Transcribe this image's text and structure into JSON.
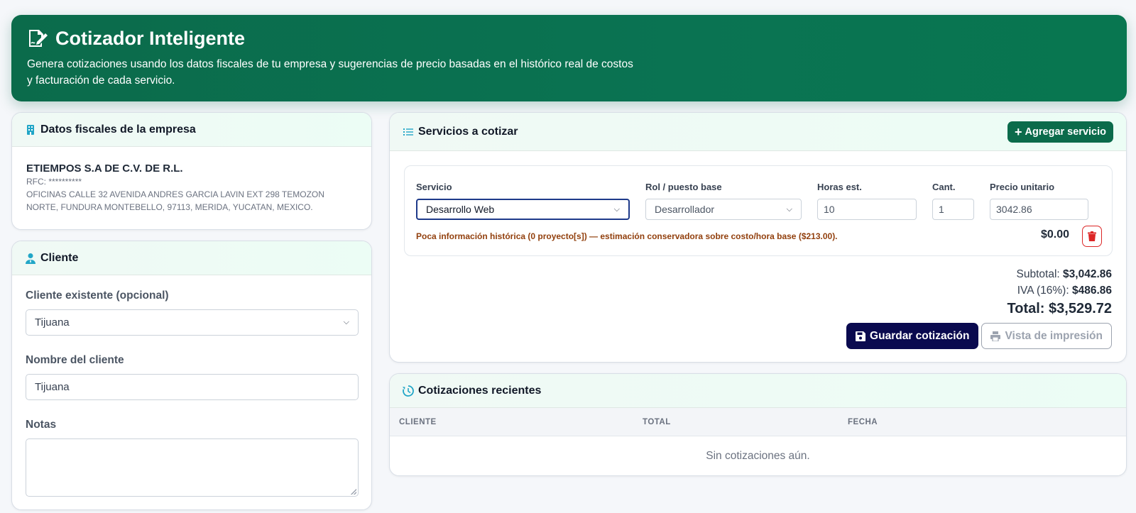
{
  "header": {
    "title": "Cotizador Inteligente",
    "subtitle": "Genera cotizaciones usando los datos fiscales de tu empresa y sugerencias de precio basadas en el histórico real de costos y facturación de cada servicio.",
    "icon": "file-signature-icon"
  },
  "fiscal": {
    "title": "Datos fiscales de la empresa",
    "company": "ETIEMPOS S.A DE C.V. DE R.L.",
    "rfc": "RFC: **********",
    "address": "OFICINAS CALLE 32 AVENIDA ANDRES GARCIA LAVIN EXT 298 TEMOZON NORTE, FUNDURA MONTEBELLO, 97113, MERIDA, YUCATAN, MEXICO."
  },
  "cliente": {
    "title": "Cliente",
    "existing_label": "Cliente existente (opcional)",
    "existing_value": "Tijuana",
    "name_label": "Nombre del cliente",
    "name_value": "Tijuana",
    "notes_label": "Notas",
    "notes_value": ""
  },
  "servicios": {
    "title": "Servicios a cotizar",
    "add_label": "Agregar servicio",
    "columns": {
      "servicio": "Servicio",
      "rol": "Rol / puesto base",
      "horas": "Horas est.",
      "cant": "Cant.",
      "precio": "Precio unitario"
    },
    "row": {
      "servicio": "Desarrollo Web",
      "rol": "Desarrollador",
      "horas": "10",
      "cant": "1",
      "precio": "3042.86",
      "warning": "Poca información histórica (0 proyecto[s]) — estimación conservadora sobre costo/hora base ($213.00).",
      "line_total": "$0.00"
    },
    "totals": {
      "subtotal_label": "Subtotal:",
      "subtotal": "$3,042.86",
      "iva_label": "IVA (16%):",
      "iva": "$486.86",
      "total_label": "Total:",
      "total": "$3,529.72"
    },
    "save_label": "Guardar cotización",
    "print_label": "Vista de impresión"
  },
  "recientes": {
    "title": "Cotizaciones recientes",
    "columns": [
      "CLIENTE",
      "TOTAL",
      "FECHA"
    ],
    "empty": "Sin cotizaciones aún."
  },
  "colors": {
    "brand": "#0b6b4b",
    "save": "#0a0a4f",
    "warning": "#92400e",
    "danger": "#dc2626",
    "icon_accent": "#22a6c7"
  }
}
